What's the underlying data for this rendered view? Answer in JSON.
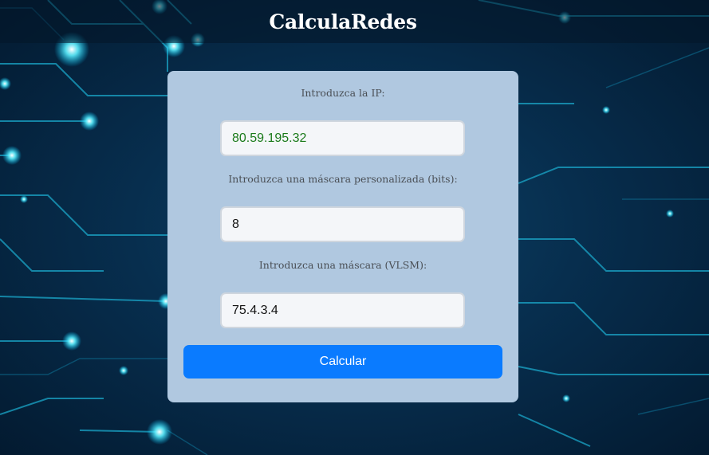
{
  "header": {
    "title": "CalculaRedes"
  },
  "form": {
    "ip_label": "Introduzca la IP:",
    "ip_value": "80.59.195.32",
    "mask_bits_label": "Introduzca una máscara personalizada (bits):",
    "mask_bits_value": "8",
    "vlsm_label": "Introduzca una máscara (VLSM):",
    "vlsm_value": "75.4.3.4",
    "submit_label": "Calcular"
  },
  "colors": {
    "card_background": "#b0c8e0",
    "button": "#0a7bff",
    "ip_text": "#1a7a1a",
    "background": "#072e4e"
  }
}
